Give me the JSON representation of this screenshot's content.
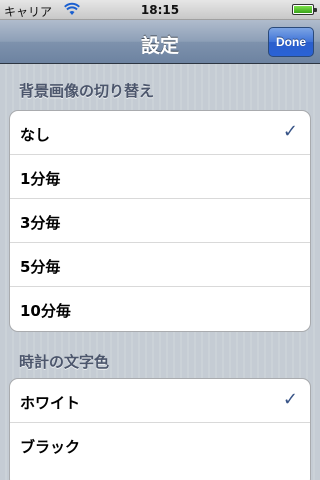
{
  "status": {
    "carrier": "キャリア",
    "time": "18:15"
  },
  "nav": {
    "title": "設定",
    "done_label": "Done"
  },
  "sections": [
    {
      "header": "背景画像の切り替え",
      "items": [
        {
          "label": "なし",
          "check": "✓"
        },
        {
          "label": "1分毎",
          "check": ""
        },
        {
          "label": "3分毎",
          "check": ""
        },
        {
          "label": "5分毎",
          "check": ""
        },
        {
          "label": "10分毎",
          "check": ""
        }
      ]
    },
    {
      "header": "時計の文字色",
      "items": [
        {
          "label": "ホワイト",
          "check": "✓"
        },
        {
          "label": "ブラック",
          "check": ""
        }
      ]
    }
  ]
}
